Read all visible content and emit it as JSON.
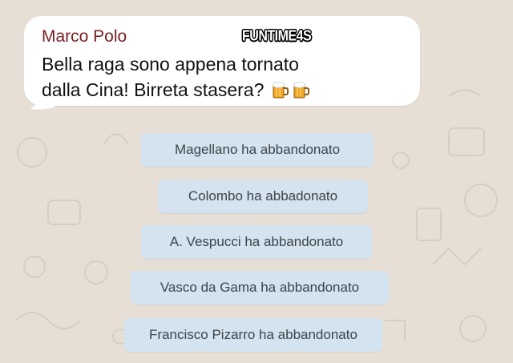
{
  "chat": {
    "sender_name": "Marco Polo",
    "watermark": "FUNTIME4S",
    "message_lines": [
      "Bella raga sono appena tornato",
      "dalla Cina! Birreta stasera?"
    ],
    "emoji": [
      "beer-mug-icon",
      "beer-mug-icon"
    ]
  },
  "system_notices": [
    "Magellano ha abbandonato",
    "Colombo ha abbadonato",
    "A. Vespucci ha abbandonato",
    "Vasco da Gama ha abbandonato",
    "Francisco Pizarro ha abbandonato"
  ],
  "colors": {
    "background": "#e7ded5",
    "bubble": "#ffffff",
    "sender_name": "#7a1e22",
    "notice_background": "#d3e3ef",
    "notice_text": "#3d4449"
  }
}
